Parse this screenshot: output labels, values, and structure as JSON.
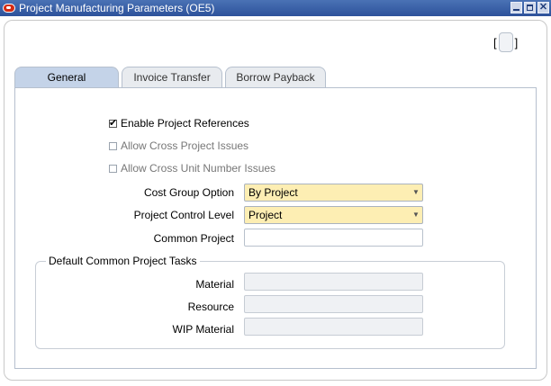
{
  "window": {
    "title": "Project Manufacturing Parameters (OE5)",
    "controls": {
      "minimize": "minimize-icon",
      "maximize": "maximize-icon",
      "close": "✕"
    }
  },
  "toolbar": {
    "bracket_left": "[",
    "bracket_right": "]"
  },
  "tabs": [
    {
      "label": "General",
      "active": true
    },
    {
      "label": "Invoice Transfer",
      "active": false
    },
    {
      "label": "Borrow Payback",
      "active": false
    }
  ],
  "general": {
    "checkboxes": [
      {
        "label": "Enable Project References",
        "checked": true,
        "enabled": true
      },
      {
        "label": "Allow Cross Project Issues",
        "checked": false,
        "enabled": false
      },
      {
        "label": "Allow Cross Unit Number Issues",
        "checked": false,
        "enabled": false
      }
    ],
    "cost_group_option": {
      "label": "Cost Group Option",
      "value": "By Project"
    },
    "project_control_level": {
      "label": "Project Control Level",
      "value": "Project"
    },
    "common_project": {
      "label": "Common Project",
      "value": ""
    },
    "tasks_group": {
      "title": "Default Common Project Tasks",
      "material": {
        "label": "Material",
        "value": ""
      },
      "resource": {
        "label": "Resource",
        "value": ""
      },
      "wip_material": {
        "label": "WIP Material",
        "value": ""
      }
    }
  },
  "colors": {
    "title_bar": "#2d529b",
    "required_field": "#fdeeb3",
    "active_tab": "#c4d3e8"
  }
}
